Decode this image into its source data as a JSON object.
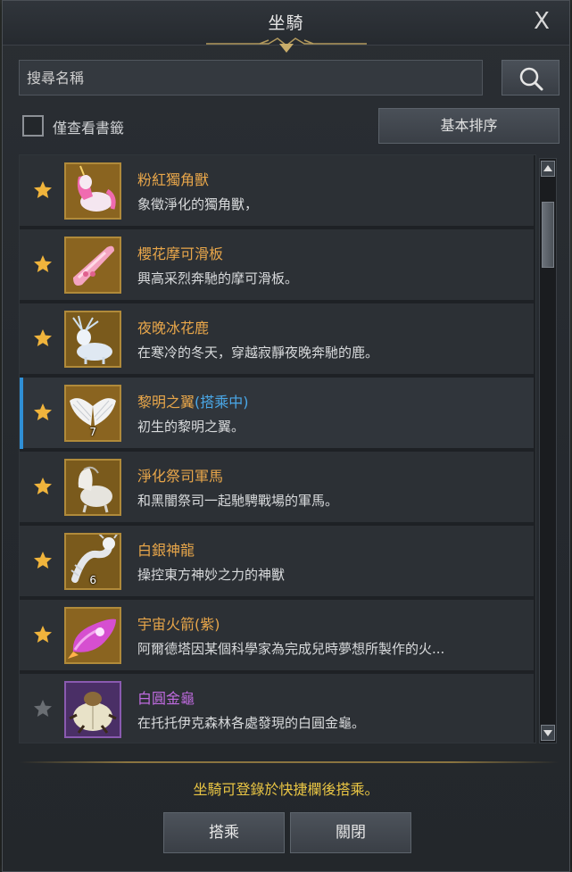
{
  "window": {
    "title": "坐騎",
    "close_label": "X"
  },
  "search": {
    "placeholder": "搜尋名稱"
  },
  "filter": {
    "bookmark_only_label": "僅查看書籤",
    "sort_label": "基本排序",
    "bookmark_only_checked": false
  },
  "colors": {
    "name_orange": "#e8a64a",
    "name_purple": "#c06be0",
    "status_blue": "#4aa8e8",
    "footer_yellow": "#e9c544",
    "selection_bar": "#2f8fd6",
    "star_gold": "#f0b43c",
    "star_gray": "#6a6e73"
  },
  "mounts": [
    {
      "name": "粉紅獨角獸",
      "status": "",
      "desc": "象徵淨化的獨角獸，",
      "starred": true,
      "rarity": "orange",
      "icon": "pink-unicorn-icon",
      "count": "",
      "active": false
    },
    {
      "name": "櫻花摩可滑板",
      "status": "",
      "desc": "興高采烈奔馳的摩可滑板。",
      "starred": true,
      "rarity": "orange",
      "icon": "cherry-skateboard-icon",
      "count": "",
      "active": false
    },
    {
      "name": "夜晚冰花鹿",
      "status": "",
      "desc": "在寒冷的冬天，穿越寂靜夜晚奔馳的鹿。",
      "starred": true,
      "rarity": "orange",
      "icon": "ice-deer-icon",
      "count": "",
      "active": false
    },
    {
      "name": "黎明之翼",
      "status": "(搭乘中)",
      "desc": "初生的黎明之翼。",
      "starred": true,
      "rarity": "orange",
      "icon": "dawn-wings-icon",
      "count": "7",
      "active": true
    },
    {
      "name": "淨化祭司軍馬",
      "status": "",
      "desc": "和黑闇祭司一起馳騁戰場的軍馬。",
      "starred": true,
      "rarity": "orange",
      "icon": "war-horse-icon",
      "count": "",
      "active": false
    },
    {
      "name": "白銀神龍",
      "status": "",
      "desc": "操控東方神妙之力的神獸",
      "starred": true,
      "rarity": "orange",
      "icon": "silver-dragon-icon",
      "count": "6",
      "active": false
    },
    {
      "name": "宇宙火箭(紫)",
      "status": "",
      "desc": "阿爾德塔因某個科學家為完成兒時夢想所製作的火...",
      "starred": true,
      "rarity": "orange",
      "icon": "space-rocket-icon",
      "count": "",
      "active": false
    },
    {
      "name": "白圓金龜",
      "status": "",
      "desc": "在托托伊克森林各處發現的白圓金龜。",
      "starred": false,
      "rarity": "purple",
      "icon": "white-beetle-icon",
      "count": "",
      "active": false
    }
  ],
  "footer": {
    "note": "坐騎可登錄於快捷欄後搭乘。",
    "ride_label": "搭乘",
    "close_label": "關閉"
  }
}
